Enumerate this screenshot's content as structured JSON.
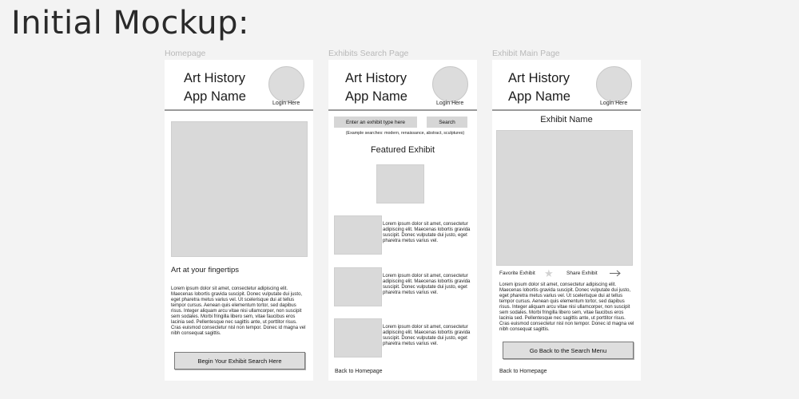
{
  "title": "Initial Mockup:",
  "common": {
    "app_name_line1": "Art History",
    "app_name_line2": "App Name",
    "login_label": "Login Here"
  },
  "homepage": {
    "frame_label": "Homepage",
    "tagline": "Art at your fingertips",
    "body_text": "Lorem ipsum dolor sit amet, consectetur adipiscing elit. Maecenas lobortis gravida suscipit. Donec vulputate dui justo, eget pharetra metus varius vel. Ut scelerisque dui at tellus tempor cursus. Aenean quis elementum tortor, sed dapibus risus. Integer aliquam arcu vitae nisi ullamcorper, non suscipit sem sodales. Morbi fringilla libero sem, vitae faucibus eros lacinia sed. Pellentesque nec sagittis ante, ut porttitor risus. Cras euismod consectetur nisl non tempor. Donec id magna vel nibh consequat sagittis.",
    "begin_button": "Begin Your Exhibit Search Here"
  },
  "search_page": {
    "frame_label": "Exhibits Search Page",
    "search_input": "Enter an exhibit type here",
    "search_button": "Search",
    "examples": "(Example searches: modern, renaissance, abstract, sculptures)",
    "featured_title": "Featured Exhibit",
    "items": [
      {
        "text": "Lorem ipsum dolor sit amet, consectetur adipiscing elit. Maecenas lobortis gravida suscipit. Donec vulputate dui justo, eget pharetra metus varius vel."
      },
      {
        "text": "Lorem ipsum dolor sit amet, consectetur adipiscing elit. Maecenas lobortis gravida suscipit. Donec vulputate dui justo, eget pharetra metus varius vel."
      },
      {
        "text": "Lorem ipsum dolor sit amet, consectetur adipiscing elit. Maecenas lobortis gravida suscipit. Donec vulputate dui justo, eget pharetra metus varius vel."
      }
    ],
    "back_link": "Back to Homepage"
  },
  "exhibit_page": {
    "frame_label": "Exhibit Main Page",
    "exhibit_name": "Exhibit Name",
    "favorite_label": "Favorite Exhibit",
    "share_label": "Share Exhibit",
    "body_text": "Lorem ipsum dolor sit amet, consectetur adipiscing elit. Maecenas lobortis gravida suscipit. Donec vulputate dui justo, eget pharetra metus varius vel. Ut scelerisque dui at tellus tempor cursus. Aenean quis elementum tortor, sed dapibus risus. Integer aliquam arcu vitae nisi ullamcorper, non suscipit sem sodales. Morbi fringilla libero sem, vitae faucibus eros lacinia sed. Pellentesque nec sagittis ante, ut porttitor risus. Cras euismod consectetur nisl non tempor. Donec id magna vel nibh consequat sagittis.",
    "back_button": "Go Back to the Search Menu",
    "back_link": "Back to Homepage"
  },
  "icons": [
    "star-icon",
    "share-arrow-icon"
  ],
  "colors": {
    "background": "#f3f3f3",
    "placeholder": "#d9d9d9",
    "frame_label": "#b8b8b8",
    "divider": "#9a9a9a"
  }
}
